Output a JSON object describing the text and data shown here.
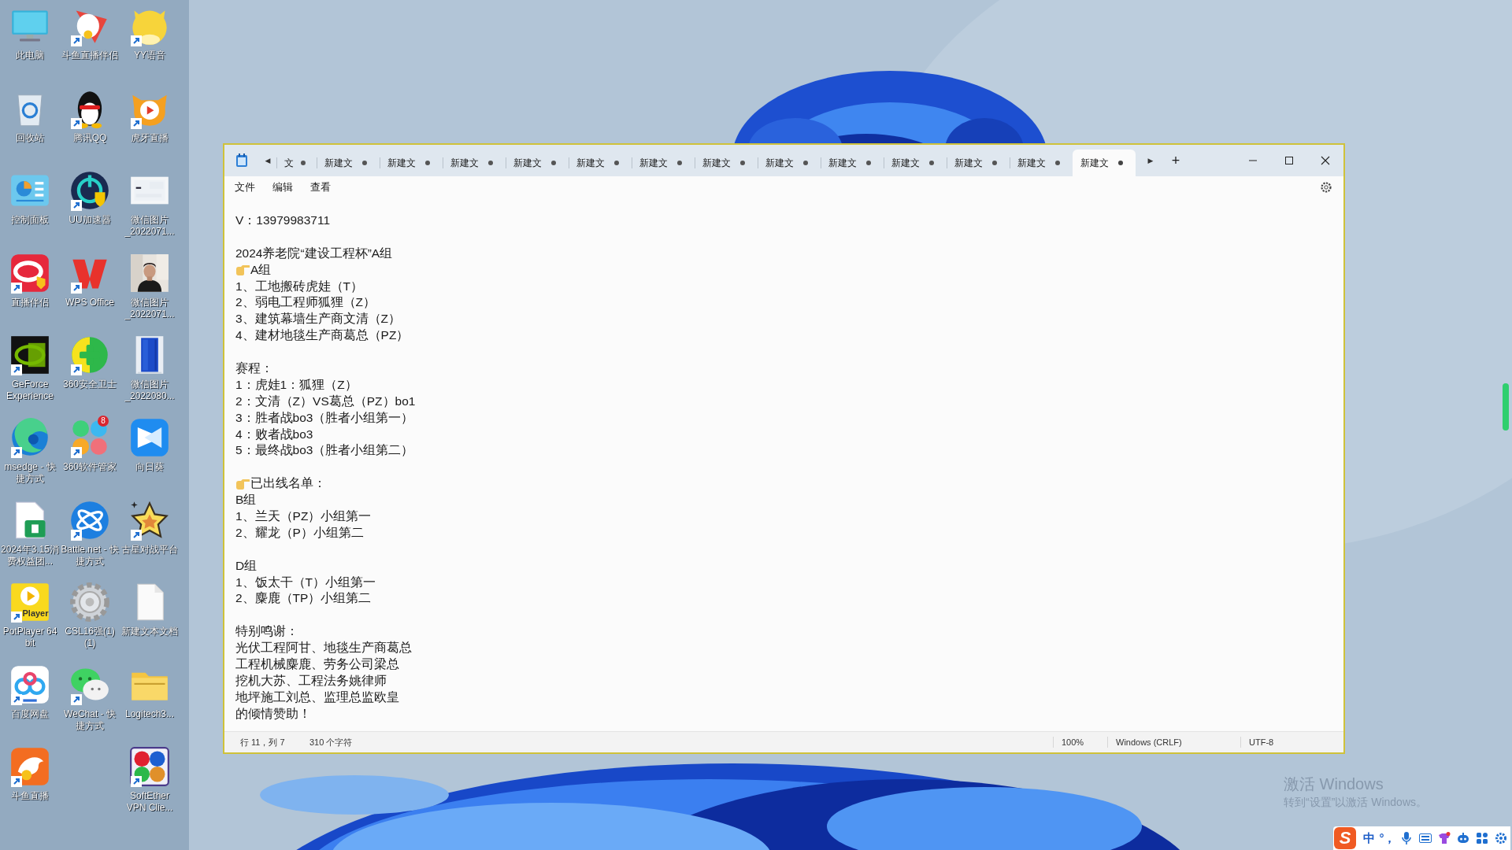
{
  "desktop": {
    "columns": [
      [
        {
          "label": "此电脑",
          "shortcut": false
        },
        {
          "label": "回收站",
          "shortcut": false
        },
        {
          "label": "控制面板",
          "shortcut": false
        },
        {
          "label": "直播伴侣",
          "shortcut": true
        },
        {
          "label": "GeForce Experience",
          "shortcut": true
        },
        {
          "label": "msedge - 快捷方式",
          "shortcut": true
        },
        {
          "label": "2024年3.15消费权益团...",
          "shortcut": false
        },
        {
          "label": "PotPlayer 64 bit",
          "shortcut": true,
          "icon_text": "Player"
        },
        {
          "label": "百度网盘",
          "shortcut": true
        },
        {
          "label": "斗鱼直播",
          "shortcut": true
        }
      ],
      [
        {
          "label": "斗鱼直播伴侣",
          "shortcut": true
        },
        {
          "label": "腾讯QQ",
          "shortcut": true
        },
        {
          "label": "UU加速器",
          "shortcut": true
        },
        {
          "label": "WPS Office",
          "shortcut": true
        },
        {
          "label": "360安全卫士",
          "shortcut": true
        },
        {
          "label": "360软件管家",
          "shortcut": true,
          "badge": "8"
        },
        {
          "label": "Battle.net - 快捷方式",
          "shortcut": true
        },
        {
          "label": "CSL16强(1)(1)",
          "shortcut": false
        },
        {
          "label": "WeChat - 快捷方式",
          "shortcut": true
        }
      ],
      [
        {
          "label": "YY语音",
          "shortcut": true
        },
        {
          "label": "虎牙直播",
          "shortcut": true
        },
        {
          "label": "微信图片_2022071...",
          "shortcut": false
        },
        {
          "label": "微信图片_2022071...",
          "shortcut": false
        },
        {
          "label": "微信图片_2022080...",
          "shortcut": false
        },
        {
          "label": "向日葵",
          "shortcut": false
        },
        {
          "label": "古星对战平台",
          "shortcut": true
        },
        {
          "label": "新建文本文档",
          "shortcut": false
        },
        {
          "label": "Logitech3...",
          "shortcut": false
        },
        {
          "label": "SoftEther VPN Clie...",
          "shortcut": true
        }
      ]
    ]
  },
  "notepad": {
    "scroll_left": "◀",
    "scroll_right": "▶",
    "new_tab": "+",
    "tabs": [
      {
        "label": "文",
        "selected": false,
        "modified": true
      },
      {
        "label": "新建文",
        "selected": false,
        "modified": true
      },
      {
        "label": "新建文",
        "selected": false,
        "modified": true
      },
      {
        "label": "新建文",
        "selected": false,
        "modified": true
      },
      {
        "label": "新建文",
        "selected": false,
        "modified": true
      },
      {
        "label": "新建文",
        "selected": false,
        "modified": true
      },
      {
        "label": "新建文",
        "selected": false,
        "modified": true
      },
      {
        "label": "新建文",
        "selected": false,
        "modified": true
      },
      {
        "label": "新建文",
        "selected": false,
        "modified": true
      },
      {
        "label": "新建文",
        "selected": false,
        "modified": true
      },
      {
        "label": "新建文",
        "selected": false,
        "modified": true
      },
      {
        "label": "新建文",
        "selected": false,
        "modified": true
      },
      {
        "label": "新建文",
        "selected": false,
        "modified": true
      },
      {
        "label": "新建文",
        "selected": true,
        "modified": true
      }
    ],
    "menu": [
      "文件",
      "编辑",
      "查看"
    ],
    "lines": [
      {
        "kind": "plain",
        "text": "V：13979983711"
      },
      {
        "kind": "blank"
      },
      {
        "kind": "plain",
        "text": "2024养老院“建设工程杯”A组"
      },
      {
        "kind": "hand",
        "text": "A组"
      },
      {
        "kind": "plain",
        "text": "1、工地搬砖虎娃（T）"
      },
      {
        "kind": "plain",
        "text": "2、弱电工程师狐狸（Z）"
      },
      {
        "kind": "plain",
        "text": "3、建筑幕墙生产商文清（Z）"
      },
      {
        "kind": "plain",
        "text": "4、建材地毯生产商葛总（PZ）"
      },
      {
        "kind": "blank"
      },
      {
        "kind": "plain",
        "text": "赛程："
      },
      {
        "kind": "plain",
        "text": "1：虎娃1：狐狸（Z）"
      },
      {
        "kind": "plain",
        "text": "2：文清（Z）VS葛总（PZ）bo1"
      },
      {
        "kind": "plain",
        "text": "3：胜者战bo3（胜者小组第一）"
      },
      {
        "kind": "plain",
        "text": "4：败者战bo3"
      },
      {
        "kind": "plain",
        "text": "5：最终战bo3（胜者小组第二）"
      },
      {
        "kind": "blank"
      },
      {
        "kind": "hand",
        "text": "已出线名单："
      },
      {
        "kind": "plain",
        "text": "B组"
      },
      {
        "kind": "plain",
        "text": "1、兰天（PZ）小组第一"
      },
      {
        "kind": "plain",
        "text": "2、耀龙（P）小组第二"
      },
      {
        "kind": "blank"
      },
      {
        "kind": "plain",
        "text": "D组"
      },
      {
        "kind": "plain",
        "text": "1、饭太干（T）小组第一"
      },
      {
        "kind": "plain",
        "text": "2、麋鹿（TP）小组第二"
      },
      {
        "kind": "blank"
      },
      {
        "kind": "plain",
        "text": "特别鸣谢："
      },
      {
        "kind": "plain",
        "text": "光伏工程阿甘、地毯生产商葛总"
      },
      {
        "kind": "plain",
        "text": "工程机械麋鹿、劳务公司梁总"
      },
      {
        "kind": "plain",
        "text": "挖机大苏、工程法务姚律师"
      },
      {
        "kind": "plain",
        "text": "地坪施工刘总、监理总监欧皇"
      },
      {
        "kind": "plain",
        "text": "的倾情赞助！"
      }
    ],
    "status_bar": {
      "position": "行 11，列 7",
      "characters": "310 个字符",
      "zoom": "100%",
      "line_ending": "Windows (CRLF)",
      "encoding": "UTF-8"
    }
  },
  "activation": {
    "title": "激活 Windows",
    "hint": "转到“设置”以激活 Windows。"
  },
  "ime_bar": {
    "logo": "S",
    "mode": "中",
    "punctuation": "°，"
  }
}
